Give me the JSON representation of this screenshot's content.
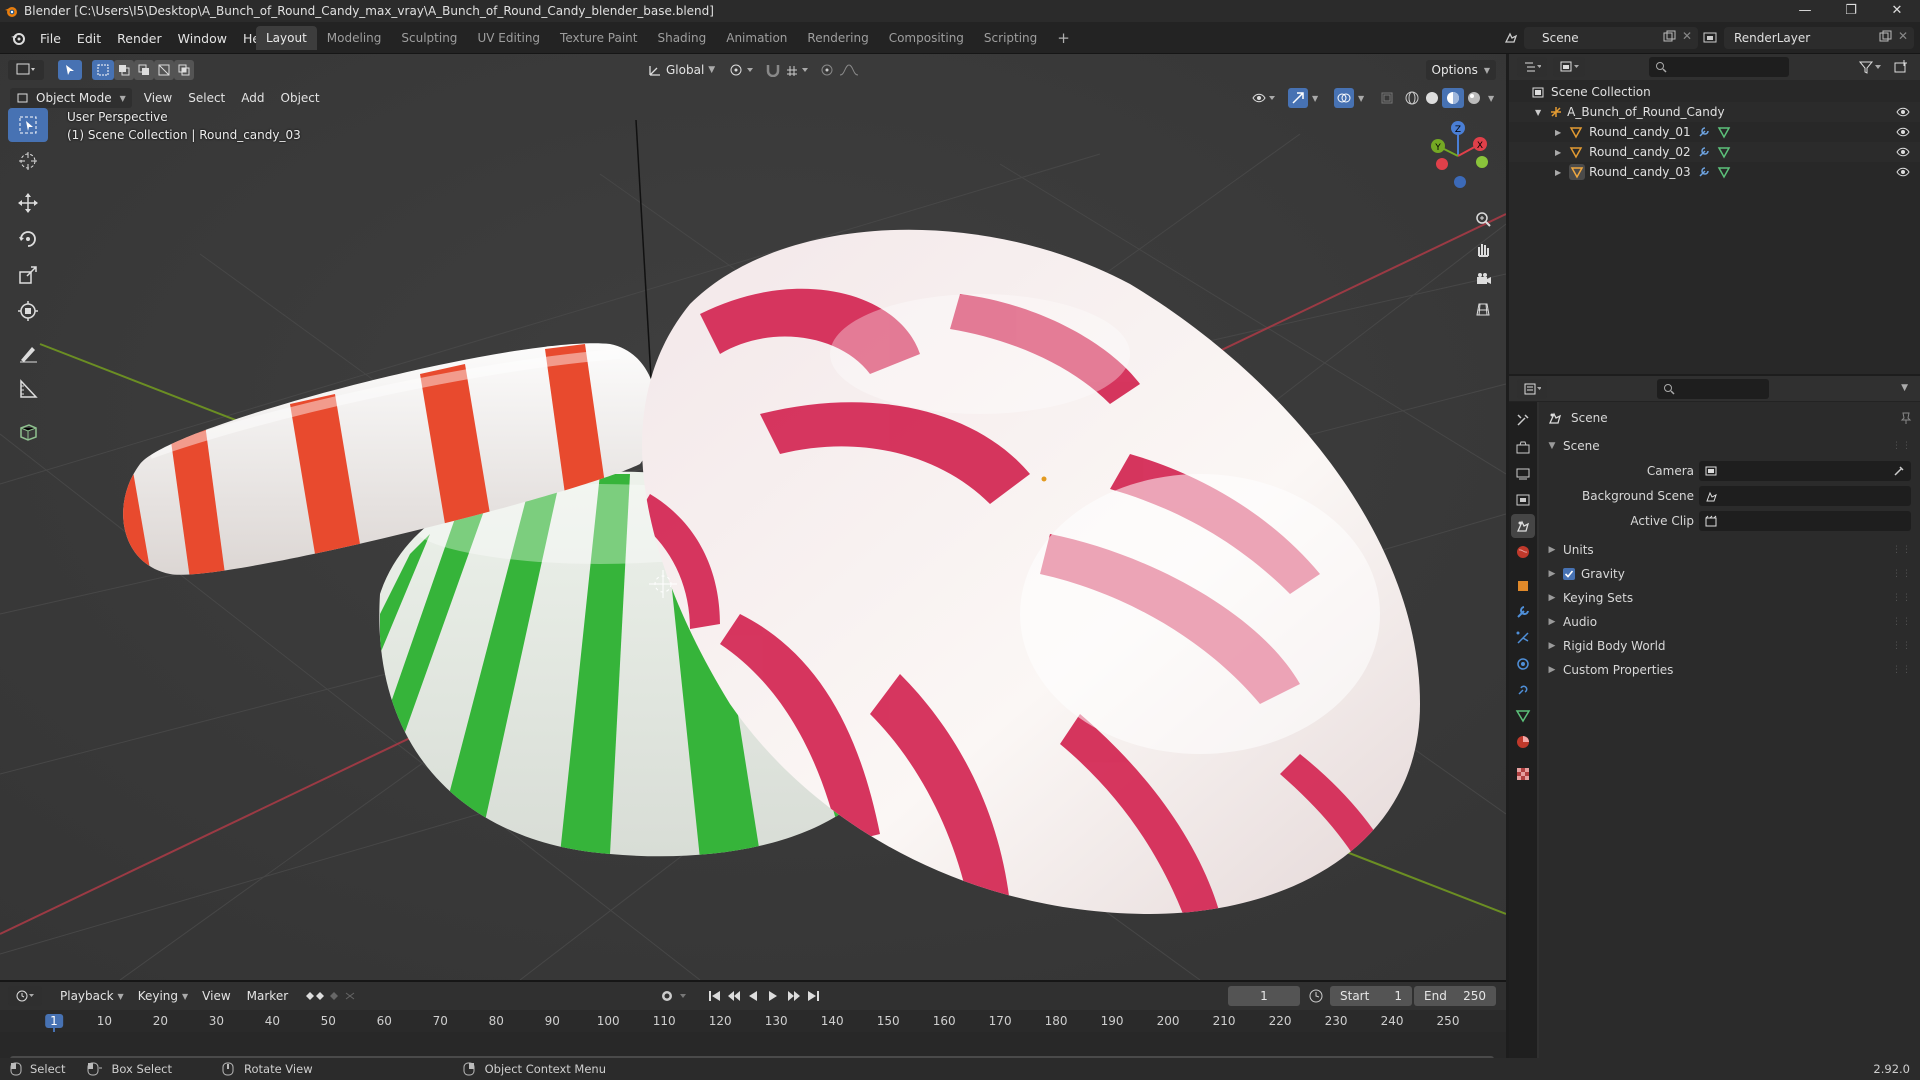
{
  "window": {
    "title": "Blender [C:\\Users\\I5\\Desktop\\A_Bunch_of_Round_Candy_max_vray\\A_Bunch_of_Round_Candy_blender_base.blend]",
    "controls": [
      "—",
      "❐",
      "✕"
    ]
  },
  "menu": [
    "File",
    "Edit",
    "Render",
    "Window",
    "Help"
  ],
  "workspaces": [
    {
      "label": "Layout",
      "active": true
    },
    {
      "label": "Modeling"
    },
    {
      "label": "Sculpting"
    },
    {
      "label": "UV Editing"
    },
    {
      "label": "Texture Paint"
    },
    {
      "label": "Shading"
    },
    {
      "label": "Animation"
    },
    {
      "label": "Rendering"
    },
    {
      "label": "Compositing"
    },
    {
      "label": "Scripting"
    }
  ],
  "workspace_add": "+",
  "scene_selector": {
    "value": "Scene"
  },
  "view_layer_selector": {
    "value": "RenderLayer"
  },
  "viewport": {
    "transform_orientation": "Global",
    "options_label": "Options",
    "mode": "Object Mode",
    "header_menus": [
      "View",
      "Select",
      "Add",
      "Object"
    ],
    "overlay_line1": "User Perspective",
    "overlay_line2": "(1) Scene Collection | Round_candy_03",
    "gizmo_axes": {
      "x": "X",
      "y": "Y",
      "z": "Z"
    },
    "colors": {
      "background": "#393939",
      "grid": "#4a4a4a",
      "x_axis": "#9b3a44",
      "y_axis": "#6b8e23",
      "select_blue": "#4772b3"
    }
  },
  "toolbar_icons": [
    "select-box-icon",
    "cursor-icon",
    "move-icon",
    "rotate-icon",
    "scale-icon",
    "transform-icon",
    "annotate-icon",
    "measure-icon",
    "add-cube-icon"
  ],
  "timeline": {
    "menus": [
      "Playback",
      "Keying",
      "View",
      "Marker"
    ],
    "current_frame": "1",
    "start_label": "Start",
    "start": "1",
    "end_label": "End",
    "end": "250",
    "ticks": [
      "1",
      "10",
      "20",
      "30",
      "40",
      "50",
      "60",
      "70",
      "80",
      "90",
      "100",
      "110",
      "120",
      "130",
      "140",
      "150",
      "160",
      "170",
      "180",
      "190",
      "200",
      "210",
      "220",
      "230",
      "240",
      "250"
    ]
  },
  "statusbar": {
    "select": "Select",
    "box_select": "Box Select",
    "rotate_view": "Rotate View",
    "context_menu": "Object Context Menu",
    "version": "2.92.0"
  },
  "outliner": {
    "root": "Scene Collection",
    "collection": "A_Bunch_of_Round_Candy",
    "objects": [
      {
        "name": "Round_candy_01"
      },
      {
        "name": "Round_candy_02"
      },
      {
        "name": "Round_candy_03",
        "selected": true
      }
    ]
  },
  "properties": {
    "context_title": "Scene",
    "panel_title": "Scene",
    "fields": [
      {
        "label": "Camera",
        "value": ""
      },
      {
        "label": "Background Scene",
        "value": ""
      },
      {
        "label": "Active Clip",
        "value": ""
      }
    ],
    "subpanels": [
      {
        "label": "Units"
      },
      {
        "label": "Gravity",
        "checkbox": true
      },
      {
        "label": "Keying Sets"
      },
      {
        "label": "Audio"
      },
      {
        "label": "Rigid Body World"
      },
      {
        "label": "Custom Properties"
      }
    ]
  }
}
